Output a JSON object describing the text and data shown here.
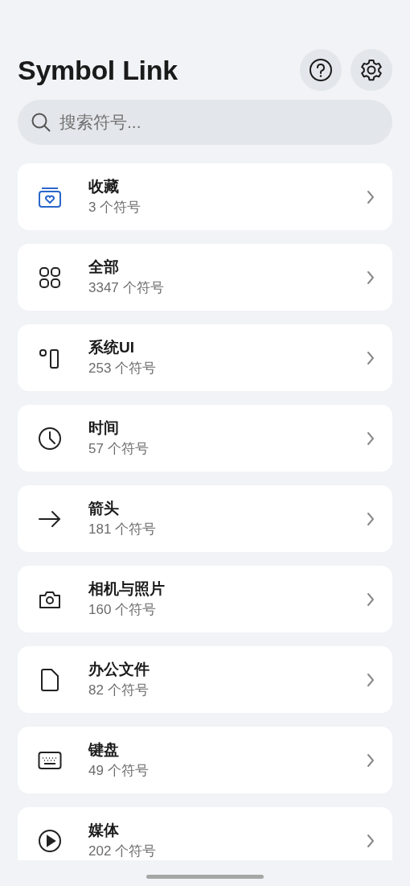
{
  "app": {
    "title": "Symbol Link"
  },
  "search": {
    "placeholder": "搜索符号..."
  },
  "categories": [
    {
      "kind": "favorites",
      "name": "收藏",
      "count": "3 个符号"
    },
    {
      "kind": "grid",
      "name": "全部",
      "count": "3347 个符号"
    },
    {
      "kind": "system",
      "name": "系统UI",
      "count": "253 个符号"
    },
    {
      "kind": "clock",
      "name": "时间",
      "count": "57 个符号"
    },
    {
      "kind": "arrow",
      "name": "箭头",
      "count": "181 个符号"
    },
    {
      "kind": "camera",
      "name": "相机与照片",
      "count": "160 个符号"
    },
    {
      "kind": "document",
      "name": "办公文件",
      "count": "82 个符号"
    },
    {
      "kind": "keyboard",
      "name": "键盘",
      "count": "49 个符号"
    },
    {
      "kind": "play",
      "name": "媒体",
      "count": "202 个符号"
    }
  ]
}
